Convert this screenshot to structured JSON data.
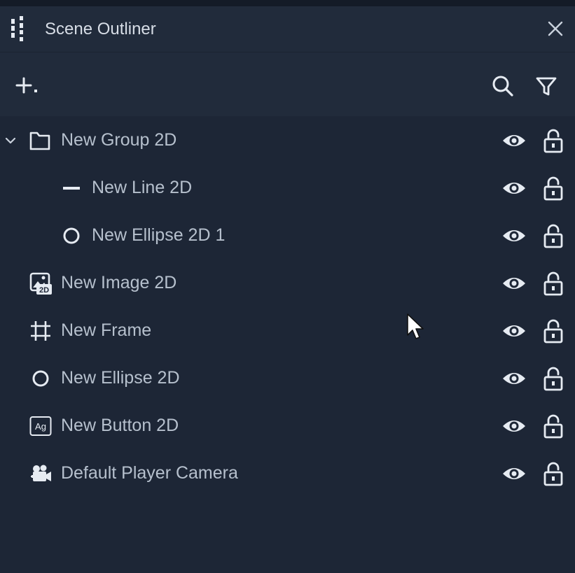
{
  "panel": {
    "title": "Scene Outliner",
    "close_icon": "close-icon",
    "grip_icon": "panel-grip-icon"
  },
  "toolbar": {
    "add_icon": "add-dropdown-icon",
    "search_icon": "search-icon",
    "filter_icon": "filter-icon"
  },
  "items": [
    {
      "label": "New Group 2D",
      "icon": "folder-icon",
      "depth": 0,
      "expanded": true,
      "visible": true,
      "locked": false
    },
    {
      "label": "New Line 2D",
      "icon": "line-icon",
      "depth": 1,
      "visible": true,
      "locked": false
    },
    {
      "label": "New Ellipse 2D 1",
      "icon": "ellipse-icon",
      "depth": 1,
      "visible": true,
      "locked": false
    },
    {
      "label": "New Image 2D",
      "icon": "image-2d-icon",
      "depth": 0,
      "visible": true,
      "locked": false
    },
    {
      "label": "New Frame",
      "icon": "frame-icon",
      "depth": 0,
      "visible": true,
      "locked": false
    },
    {
      "label": "New Ellipse 2D",
      "icon": "ellipse-icon",
      "depth": 0,
      "visible": true,
      "locked": false
    },
    {
      "label": "New Button 2D",
      "icon": "button-2d-icon",
      "depth": 0,
      "visible": true,
      "locked": false
    },
    {
      "label": "Default Player Camera",
      "icon": "camera-icon",
      "depth": 0,
      "visible": true,
      "locked": false
    }
  ],
  "icon_text": {
    "image_badge": "2D",
    "button_badge": "Ag"
  },
  "colors": {
    "background": "#1d2636",
    "header": "#212b3b",
    "text": "#b6c0cd",
    "icon": "#e6ebf2"
  }
}
